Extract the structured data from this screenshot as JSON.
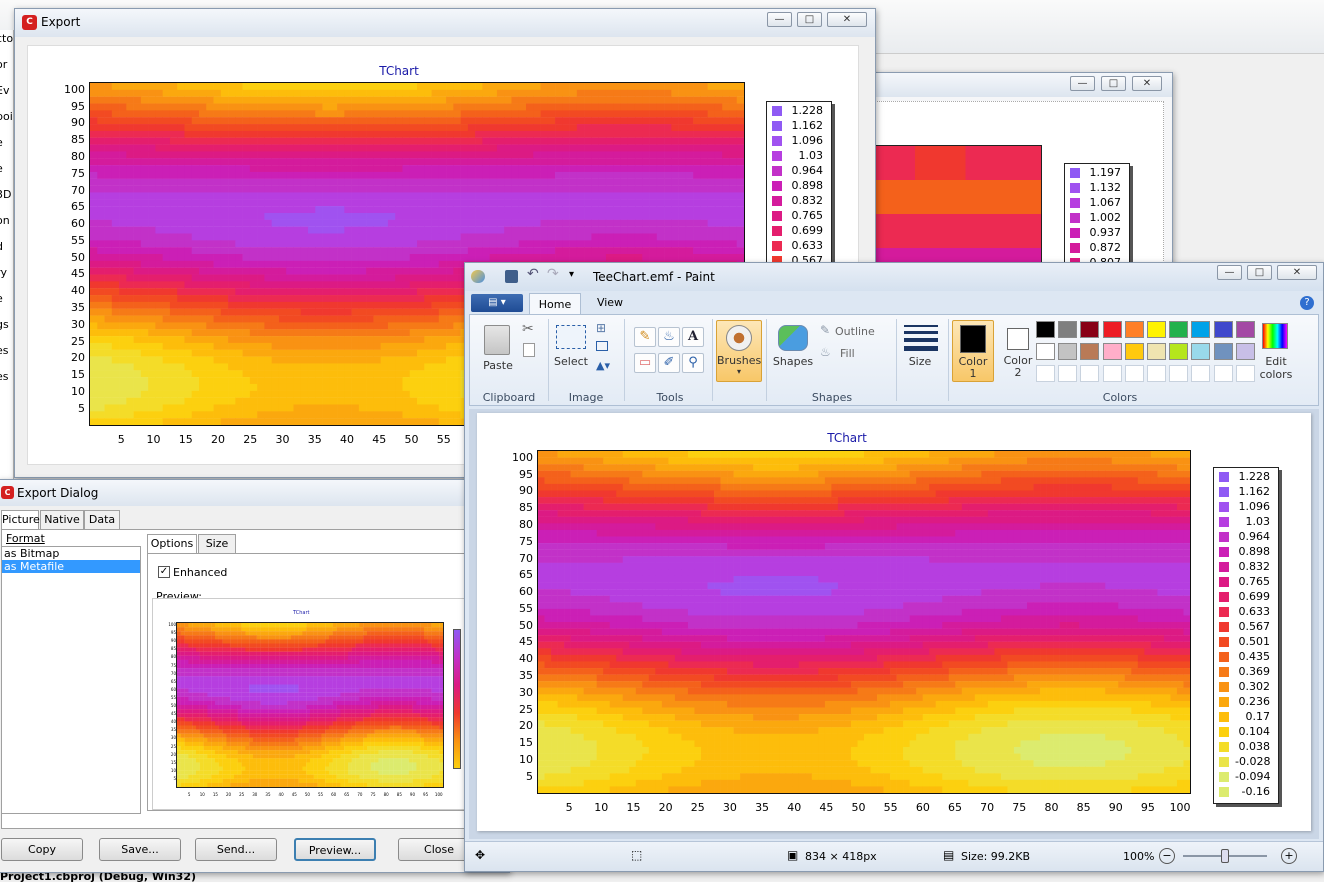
{
  "palette": [
    "#8f5af4",
    "#a052f0",
    "#b63ee0",
    "#c231c8",
    "#cb1fb6",
    "#d41b9c",
    "#dc1a84",
    "#e41e6d",
    "#ec2a52",
    "#f0382f",
    "#f24a22",
    "#f4611b",
    "#f67a17",
    "#f99213",
    "#fba80e",
    "#fdbd0b",
    "#fcd00f",
    "#f4dc28",
    "#eae44a",
    "#dceb6e"
  ],
  "chart_range": {
    "min": -0.16,
    "max": 1.228
  },
  "background_window": {
    "partial_labels": [
      "cto",
      "or",
      "Ev",
      "poir",
      "e",
      "e",
      "3D",
      "on",
      "d",
      "ry",
      "e",
      "gs",
      "es",
      "es"
    ]
  },
  "export_window": {
    "title": "Export",
    "chart": {
      "title": "TChart",
      "y_ticks": [
        "100",
        "95",
        "90",
        "85",
        "80",
        "75",
        "70",
        "65",
        "60",
        "55",
        "50",
        "45",
        "40",
        "35",
        "30",
        "25",
        "20",
        "15",
        "10",
        "5"
      ],
      "x_ticks": [
        "5",
        "10",
        "15",
        "20",
        "25",
        "30",
        "35",
        "40",
        "45",
        "50",
        "55"
      ],
      "legend": [
        "1.228",
        "1.162",
        "1.096",
        "1.03",
        "0.964",
        "0.898",
        "0.832",
        "0.765",
        "0.699",
        "0.633",
        "0.567"
      ]
    }
  },
  "second_window": {
    "legend": [
      "1.197",
      "1.132",
      "1.067",
      "1.002",
      "0.937",
      "0.872",
      "0.807"
    ]
  },
  "export_dialog": {
    "title": "Export Dialog",
    "tabs": [
      "Picture",
      "Native",
      "Data"
    ],
    "format_label": "Format",
    "formats": [
      "as Bitmap",
      "as Metafile"
    ],
    "selected_format": "as Metafile",
    "option_tabs": [
      "Options",
      "Size"
    ],
    "enhanced_label": "Enhanced",
    "enhanced_checked": true,
    "preview_label": "Preview:",
    "preview_title": "TChart",
    "preview_y_ticks": [
      "100",
      "95",
      "90",
      "85",
      "80",
      "75",
      "70",
      "65",
      "60",
      "55",
      "50",
      "45",
      "40",
      "35",
      "30",
      "25",
      "20",
      "15",
      "10",
      "5"
    ],
    "preview_x_ticks": [
      "5",
      "10",
      "15",
      "20",
      "25",
      "30",
      "35",
      "40",
      "45",
      "50",
      "55",
      "60",
      "65",
      "70",
      "75",
      "80",
      "85",
      "90",
      "95",
      "100"
    ],
    "buttons": {
      "copy": "Copy",
      "save": "Save...",
      "send": "Send...",
      "preview": "Preview...",
      "close": "Close"
    }
  },
  "status_text": "Project1.cbproj (Debug, Win32)",
  "paint_window": {
    "title": "TeeChart.emf - Paint",
    "tabs": {
      "home": "Home",
      "view": "View"
    },
    "ribbon": {
      "paste": "Paste",
      "clipboard": "Clipboard",
      "select": "Select",
      "image": "Image",
      "tools": "Tools",
      "brushes": "Brushes",
      "shapes_btn": "Shapes",
      "outline": "Outline",
      "fill": "Fill",
      "shapes_group": "Shapes",
      "size": "Size",
      "color1": "Color 1",
      "color2": "Color 2",
      "colors": "Colors",
      "edit_colors": "Edit colors"
    },
    "swatches": [
      "#000000",
      "#7f7f7f",
      "#880015",
      "#ed1c24",
      "#ff7f27",
      "#fff200",
      "#22b14c",
      "#00a2e8",
      "#3f48cc",
      "#a349a4",
      "#ffffff",
      "#c3c3c3",
      "#b97a57",
      "#ffaec9",
      "#ffc90e",
      "#efe4b0",
      "#b5e61d",
      "#99d9ea",
      "#7092be",
      "#c8bfe7"
    ],
    "chart": {
      "title": "TChart",
      "y_ticks": [
        "100",
        "95",
        "90",
        "85",
        "80",
        "75",
        "70",
        "65",
        "60",
        "55",
        "50",
        "45",
        "40",
        "35",
        "30",
        "25",
        "20",
        "15",
        "10",
        "5"
      ],
      "x_ticks": [
        "5",
        "10",
        "15",
        "20",
        "25",
        "30",
        "35",
        "40",
        "45",
        "50",
        "55",
        "60",
        "65",
        "70",
        "75",
        "80",
        "85",
        "90",
        "95",
        "100"
      ],
      "legend": [
        "1.228",
        "1.162",
        "1.096",
        "1.03",
        "0.964",
        "0.898",
        "0.832",
        "0.765",
        "0.699",
        "0.633",
        "0.567",
        "0.501",
        "0.435",
        "0.369",
        "0.302",
        "0.236",
        "0.17",
        "0.104",
        "0.038",
        "-0.028",
        "-0.094",
        "-0.16"
      ]
    },
    "status": {
      "dimensions": "834 × 418px",
      "size": "Size: 99.2KB",
      "zoom": "100%"
    }
  }
}
